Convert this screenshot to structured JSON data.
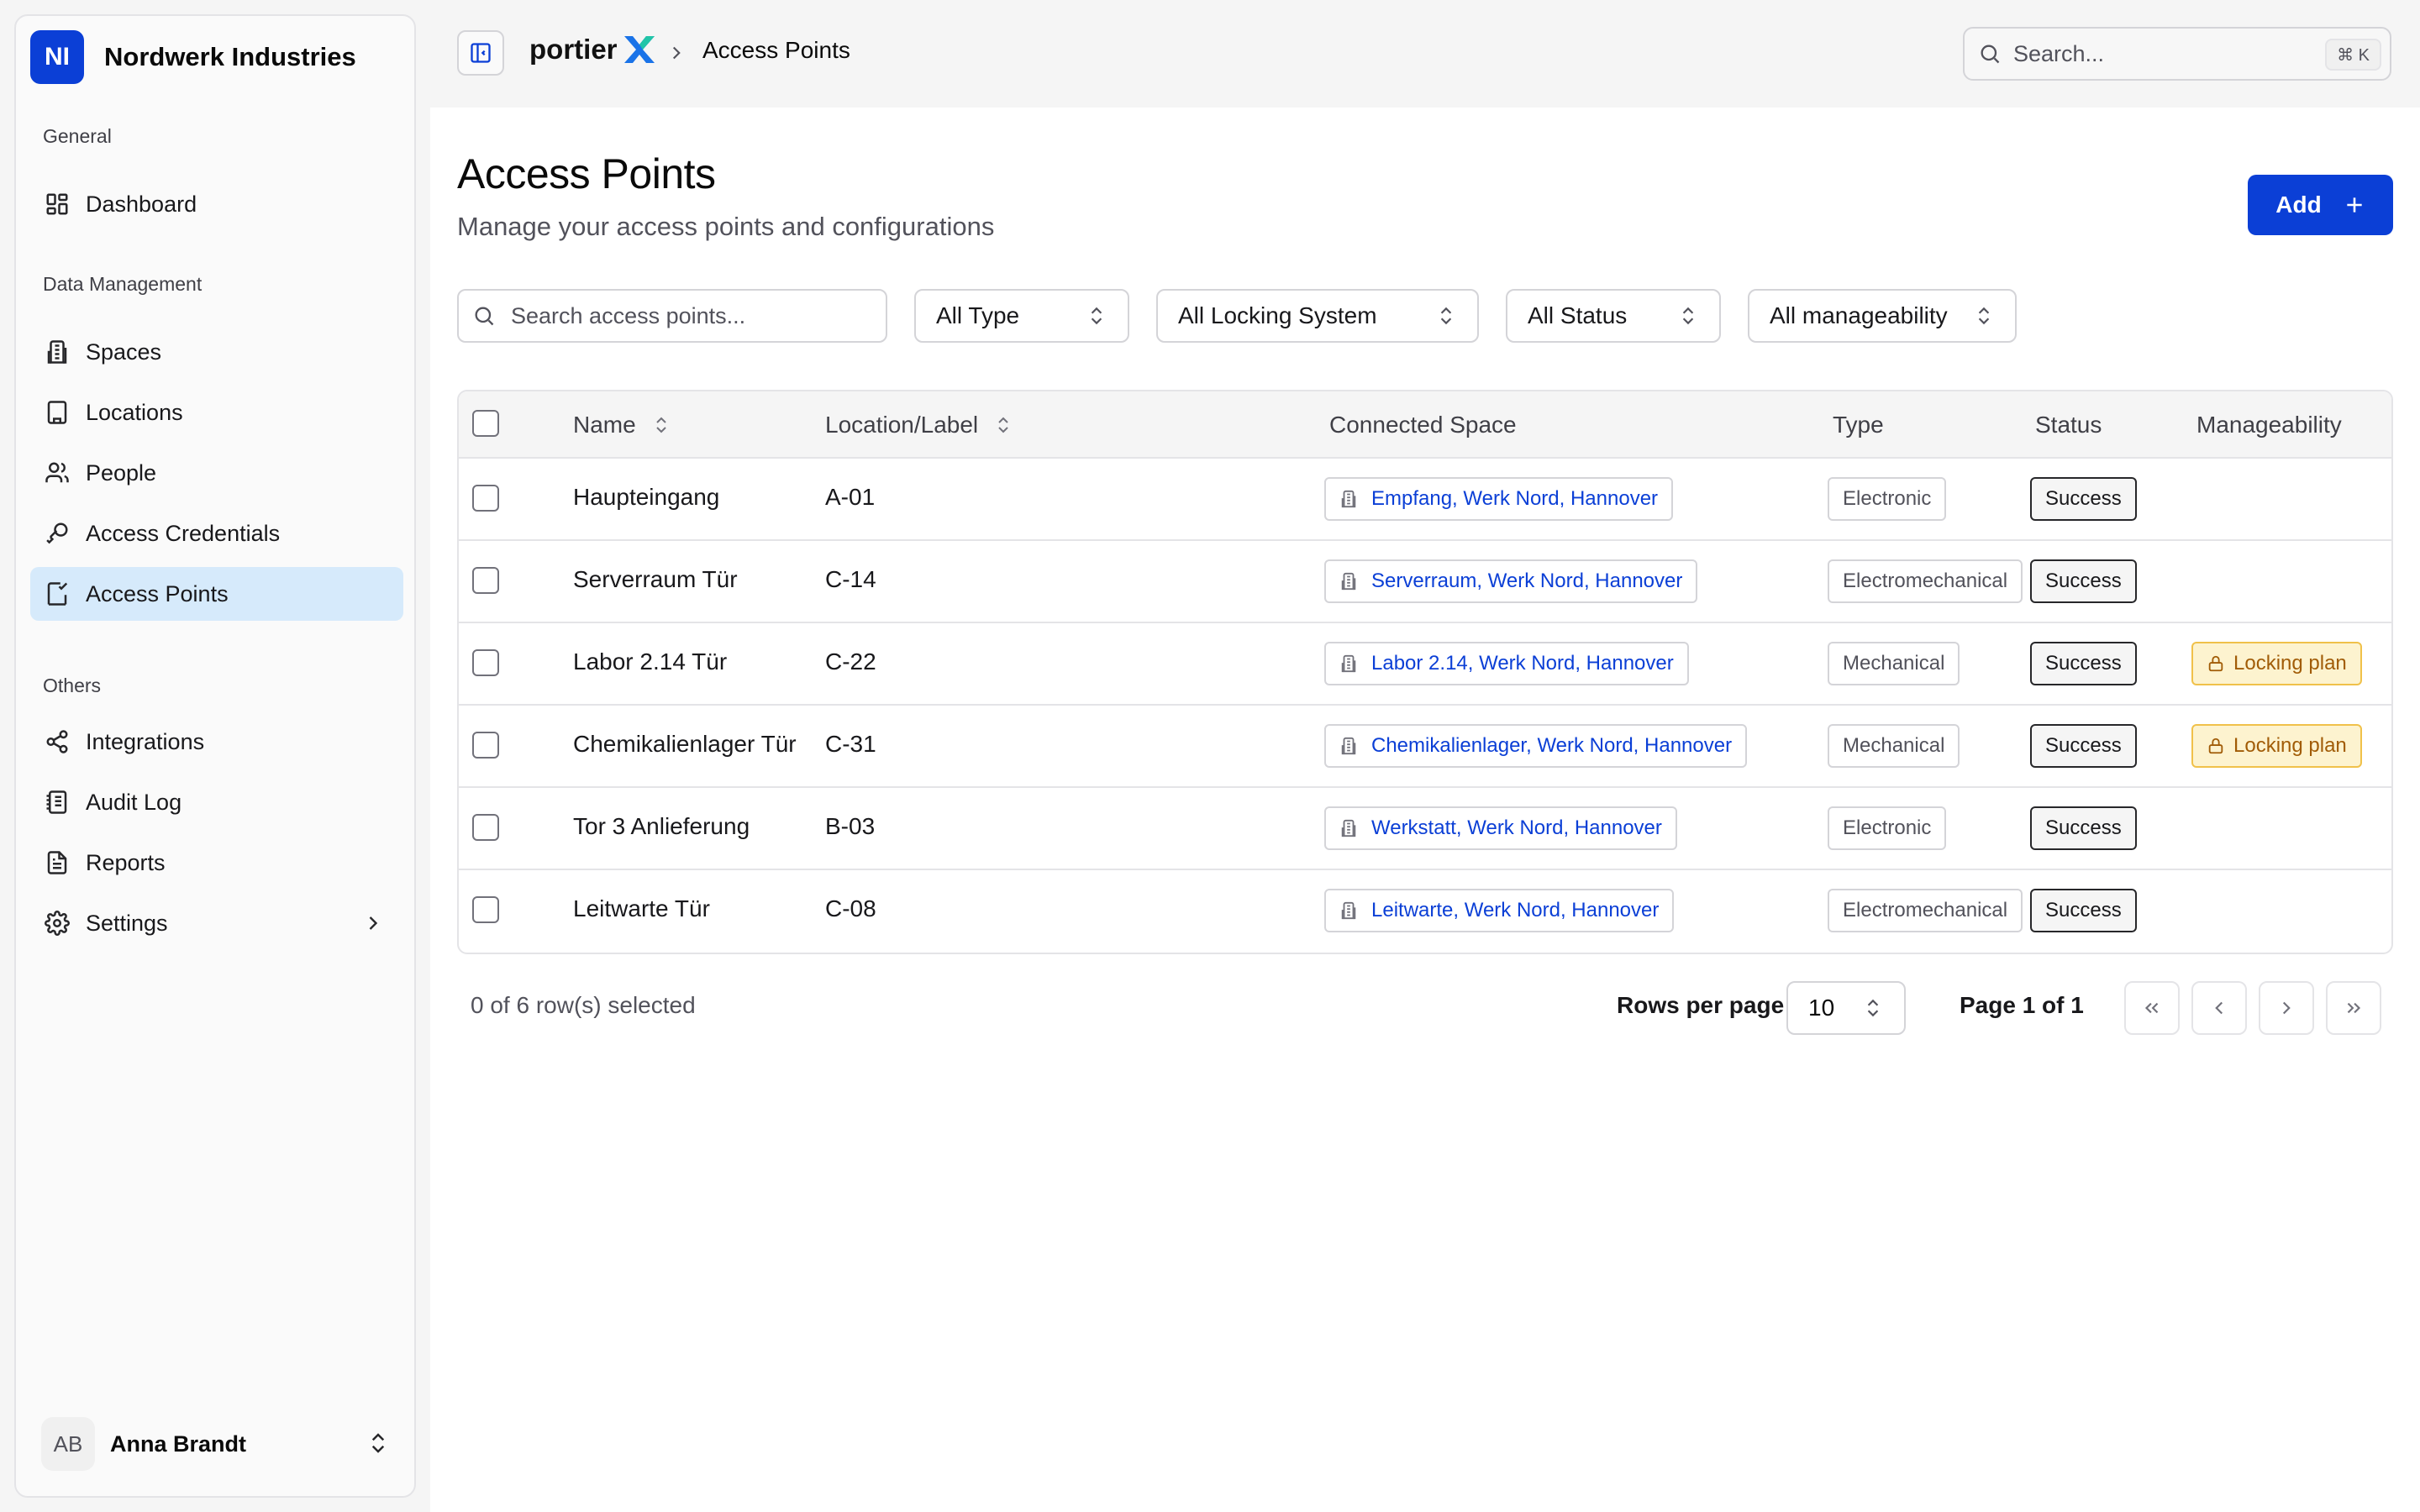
{
  "org": {
    "initials": "NI",
    "name": "Nordwerk Industries"
  },
  "nav": {
    "general_label": "General",
    "data_label": "Data Management",
    "others_label": "Others",
    "items": [
      {
        "label": "Dashboard",
        "icon": "dashboard-icon"
      },
      {
        "label": "Spaces",
        "icon": "building-icon"
      },
      {
        "label": "Locations",
        "icon": "buildings-icon"
      },
      {
        "label": "People",
        "icon": "users-icon"
      },
      {
        "label": "Access Credentials",
        "icon": "key-icon"
      },
      {
        "label": "Access Points",
        "icon": "door-icon",
        "active": true
      },
      {
        "label": "Integrations",
        "icon": "share-icon"
      },
      {
        "label": "Audit Log",
        "icon": "log-icon"
      },
      {
        "label": "Reports",
        "icon": "file-icon"
      },
      {
        "label": "Settings",
        "icon": "gear-icon"
      }
    ]
  },
  "user": {
    "initials": "AB",
    "name": "Anna Brandt"
  },
  "topbar": {
    "brand": "portier",
    "breadcrumb_current": "Access Points",
    "search_placeholder": "Search...",
    "search_shortcut": "⌘ K"
  },
  "page": {
    "title": "Access Points",
    "subtitle": "Manage your access points and configurations",
    "add_label": "Add"
  },
  "filters": {
    "search_placeholder": "Search access points...",
    "type": "All Type",
    "locking_system": "All Locking System",
    "status": "All Status",
    "manageability": "All manageability"
  },
  "table": {
    "columns": {
      "name": "Name",
      "location": "Location/Label",
      "space": "Connected Space",
      "type": "Type",
      "status": "Status",
      "manageability": "Manageability"
    },
    "rows": [
      {
        "name": "Haupteingang",
        "label": "A-01",
        "space": "Empfang, Werk Nord, Hannover",
        "type": "Electronic",
        "status": "Success",
        "manageability": ""
      },
      {
        "name": "Serverraum Tür",
        "label": "C-14",
        "space": "Serverraum, Werk Nord, Hannover",
        "type": "Electromechanical",
        "status": "Success",
        "manageability": ""
      },
      {
        "name": "Labor 2.14 Tür",
        "label": "C-22",
        "space": "Labor 2.14, Werk Nord, Hannover",
        "type": "Mechanical",
        "status": "Success",
        "manageability": "Locking plan"
      },
      {
        "name": "Chemikalienlager Tür",
        "label": "C-31",
        "space": "Chemikalienlager, Werk Nord, Hannover",
        "type": "Mechanical",
        "status": "Success",
        "manageability": "Locking plan"
      },
      {
        "name": "Tor 3 Anlieferung",
        "label": "B-03",
        "space": "Werkstatt, Werk Nord, Hannover",
        "type": "Electronic",
        "status": "Success",
        "manageability": ""
      },
      {
        "name": "Leitwarte Tür",
        "label": "C-08",
        "space": "Leitwarte, Werk Nord, Hannover",
        "type": "Electromechanical",
        "status": "Success",
        "manageability": ""
      }
    ]
  },
  "footer": {
    "selection": "0 of 6 row(s) selected",
    "rows_per_page_label": "Rows per page",
    "rows_per_page": "10",
    "page_info": "Page 1 of 1"
  },
  "colors": {
    "accent": "#0b3fd6",
    "active_nav": "#d6eafb",
    "warning_bg": "#fdf3cf",
    "warning_text": "#a15c07"
  }
}
